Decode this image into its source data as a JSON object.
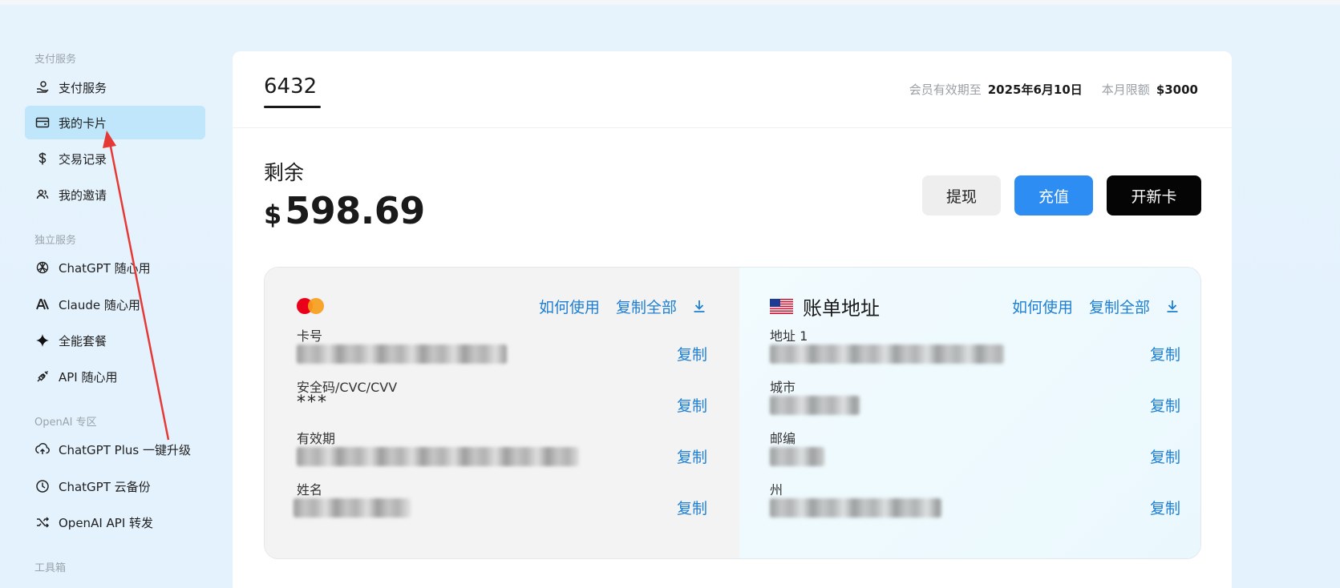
{
  "sidebar": {
    "sections": [
      {
        "label": "支付服务"
      },
      {
        "label": "独立服务"
      },
      {
        "label": "OpenAI 专区"
      },
      {
        "label": "工具箱"
      }
    ],
    "items": [
      {
        "label": "支付服务",
        "icon": "payment-icon"
      },
      {
        "label": "我的卡片",
        "icon": "card-icon",
        "active": true
      },
      {
        "label": "交易记录",
        "icon": "dollar-icon"
      },
      {
        "label": "我的邀请",
        "icon": "users-icon"
      },
      {
        "label": "ChatGPT 随心用",
        "icon": "openai-icon"
      },
      {
        "label": "Claude 随心用",
        "icon": "anthropic-icon"
      },
      {
        "label": "全能套餐",
        "icon": "sparkle-icon"
      },
      {
        "label": "API 随心用",
        "icon": "plug-icon"
      },
      {
        "label": "ChatGPT Plus 一键升级",
        "icon": "upgrade-icon"
      },
      {
        "label": "ChatGPT 云备份",
        "icon": "clock-icon"
      },
      {
        "label": "OpenAI API 转发",
        "icon": "shuffle-icon"
      }
    ]
  },
  "header": {
    "tab_title": "6432",
    "membership_label": "会员有效期至",
    "membership_date": "2025年6月10日",
    "limit_label": "本月限额",
    "limit_value": "$3000"
  },
  "balance": {
    "label": "剩余",
    "currency": "$",
    "amount": "598.69"
  },
  "actions": {
    "withdraw": "提现",
    "recharge": "充值",
    "new_card": "开新卡"
  },
  "card": {
    "how_to_use": "如何使用",
    "copy_all": "复制全部",
    "fields": [
      {
        "label": "卡号",
        "value_masked": true
      },
      {
        "label": "安全码/CVC/CVV",
        "value": "***"
      },
      {
        "label": "有效期",
        "value_masked": true
      },
      {
        "label": "姓名",
        "value_masked": true
      }
    ],
    "copy_label": "复制"
  },
  "billing": {
    "title": "账单地址",
    "how_to_use": "如何使用",
    "copy_all": "复制全部",
    "fields": [
      {
        "label": "地址 1",
        "value_masked": true
      },
      {
        "label": "城市",
        "value_masked": true
      },
      {
        "label": "邮编",
        "value_masked": true
      },
      {
        "label": "州",
        "value_masked": true
      }
    ],
    "copy_label": "复制"
  },
  "colors": {
    "accent": "#2e8df2",
    "link": "#1f7fd1",
    "active_nav": "#bfe6fb"
  }
}
